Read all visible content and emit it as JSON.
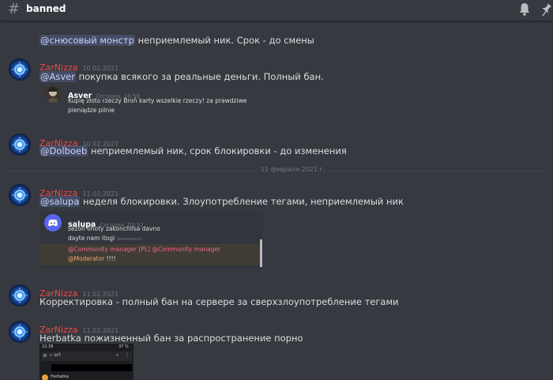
{
  "header": {
    "hash": "#",
    "channel_name": "banned"
  },
  "messages": [
    {
      "mention": "@снюсовый монстр",
      "text": "неприемлемый ник. Срок - до смены"
    },
    {
      "username": "ZarNizza",
      "timestamp": "10.02.2021",
      "mention": "@Asver",
      "text": "покупка всякого за реальные деньги. Полный бан.",
      "embed": {
        "name": "Asver",
        "time": "Сегодня, 18:59",
        "lines": [
          "Kupię złoto rzeczy Broń karty wszelkie rzeczy! za prawdziwe",
          "pieniądze pilnie"
        ]
      }
    },
    {
      "username": "ZarNizza",
      "timestamp": "10.02.2021",
      "mention": "@Dolboeb",
      "text": "неприемлемый ник, срок блокировки - до изменения"
    },
    {
      "username": "ZarNizza",
      "timestamp": "11.02.2021",
      "mention": "@salupa",
      "text": "неделя блокировки. Злоупотребление тегами, неприемлемый ник",
      "embed": {
        "name": "salupa",
        "time": "Сегодня, 03:32",
        "line1": "sezon ohoty zakonchilsa davno",
        "line2": "dayte nam itogi",
        "edited": "(изменено)",
        "ping1": "@Community manager [PL] @Community manager",
        "ping2": "@Moderator",
        "ping2_suffix": "!!!!"
      }
    },
    {
      "username": "ZarNizza",
      "timestamp": "11.02.2021",
      "text": "Корректировка - полный бан на сервере за сверхзлоупотребление тегами"
    },
    {
      "username": "ZarNizza",
      "timestamp": "11.02.2021",
      "text": "Herbatka пожизненный бан за распространение порно",
      "screenshot": {
        "status_left": "22:38",
        "status_right": "37 %",
        "search_text": "art",
        "user_line": "Herbatka"
      }
    }
  ],
  "date_divider": "11 февраля 2021 г.",
  "colors": {
    "background": "#36393f",
    "username": "#f04747",
    "mention_bg": "#414675",
    "mention_text": "#c9d2f8",
    "divider_text": "#72767d"
  },
  "icons": [
    "hash-icon",
    "bell-icon",
    "pin-icon",
    "discord-logo-icon"
  ]
}
